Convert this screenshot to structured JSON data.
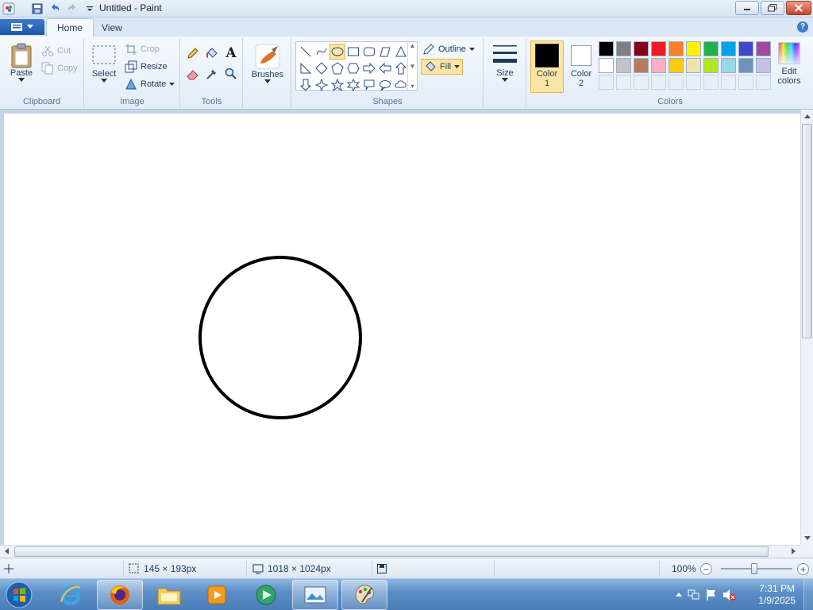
{
  "window": {
    "title": "Untitled - Paint"
  },
  "tabs": [
    {
      "label": "Home"
    },
    {
      "label": "View"
    }
  ],
  "help_glyph": "?",
  "ribbon": {
    "clipboard": {
      "paste_label": "Paste",
      "cut_label": "Cut",
      "copy_label": "Copy",
      "group_label": "Clipboard"
    },
    "image": {
      "select_label": "Select",
      "crop_label": "Crop",
      "resize_label": "Resize",
      "rotate_label": "Rotate",
      "group_label": "Image"
    },
    "tools": {
      "text_glyph": "A",
      "group_label": "Tools"
    },
    "brushes": {
      "label": "Brushes"
    },
    "shapes": {
      "outline_label": "Outline",
      "fill_label": "Fill",
      "group_label": "Shapes",
      "selected": "oval"
    },
    "size": {
      "label": "Size"
    },
    "colors": {
      "color1_label": "Color",
      "color1_num": "1",
      "color2_label": "Color",
      "color2_num": "2",
      "color1_value": "#000000",
      "color2_value": "#ffffff",
      "edit_label": "Edit",
      "edit_label2": "colors",
      "group_label": "Colors",
      "palette_row1": [
        "#000000",
        "#7f7f7f",
        "#880015",
        "#ed1c24",
        "#ff7f27",
        "#fff200",
        "#22b14c",
        "#00a2e8",
        "#3f48cc",
        "#a349a4"
      ],
      "palette_row2": [
        "#ffffff",
        "#c3c3c3",
        "#b97a57",
        "#ffaec9",
        "#ffc90e",
        "#efe4b0",
        "#b5e61d",
        "#99d9ea",
        "#7092be",
        "#c8bfe7"
      ]
    }
  },
  "canvas": {
    "shape": "circle",
    "stroke_color": "#000000"
  },
  "status": {
    "cursor_position": "",
    "selection_size": "145 × 193px",
    "canvas_size": "1018 × 1024px",
    "zoom": "100%",
    "zoom_minus": "−",
    "zoom_plus": "+"
  },
  "taskbar": {
    "time": "7:31 PM",
    "date": "1/9/2025"
  }
}
